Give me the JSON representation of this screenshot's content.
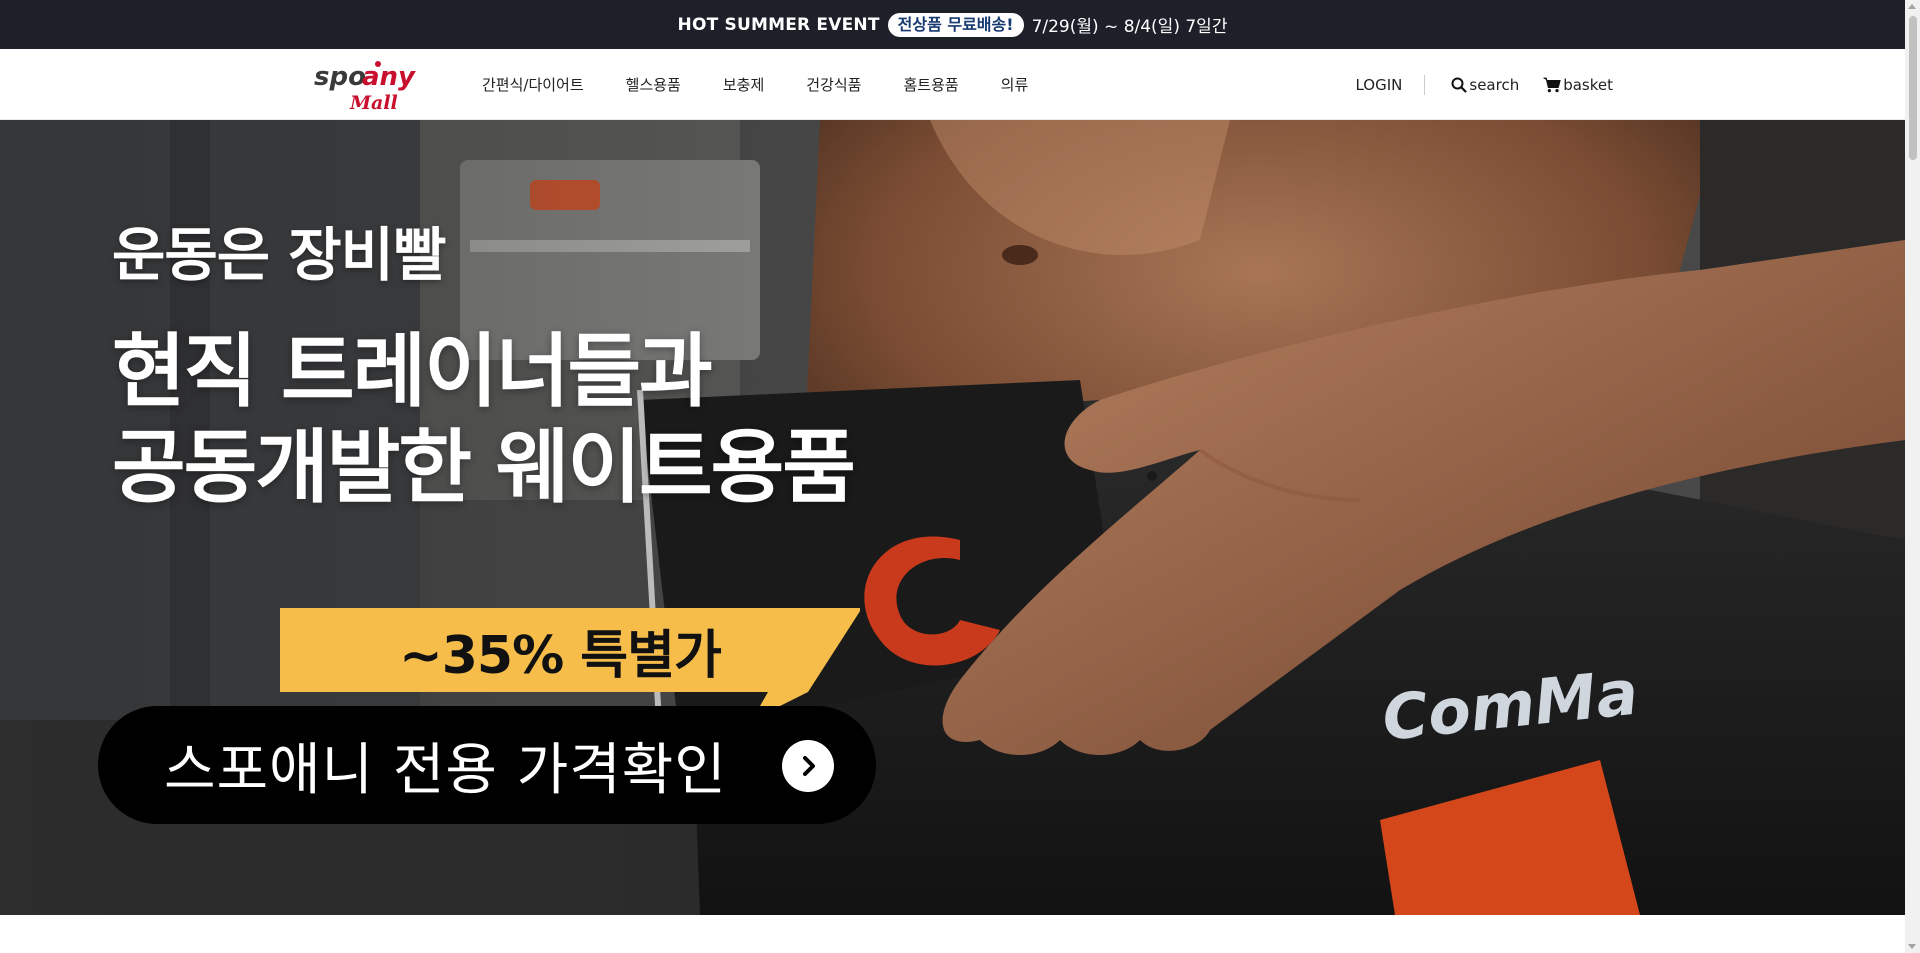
{
  "event_bar": {
    "title": "HOT SUMMER EVENT",
    "badge": "전상품 무료배송!",
    "dates": "7/29(월) ~ 8/4(일) 7일간",
    "background": "#1d1f29",
    "badge_text_color": "#163a70"
  },
  "header": {
    "logo_alt": "spoany mall",
    "logo_word_top": "spo",
    "logo_word_top_suffix": "any",
    "logo_word_bottom": "Mall",
    "nav": [
      {
        "label": "간편식/다이어트"
      },
      {
        "label": "헬스용품"
      },
      {
        "label": "보충제"
      },
      {
        "label": "건강식품"
      },
      {
        "label": "홈트용품"
      },
      {
        "label": "의류"
      }
    ],
    "login": "LOGIN",
    "search": "search",
    "basket": "basket",
    "search_icon": "search-icon",
    "basket_icon": "cart-icon"
  },
  "hero": {
    "subtitle": "운동은 장비빨",
    "title_line1": "현직 트레이너들과",
    "title_line2": "공동개발한 웨이트용품",
    "promo": "~35% 특별가",
    "promo_color": "#f6bd4b",
    "cta": "스포애니 전용 가격확인",
    "cta_icon": "chevron-right-icon",
    "belt_brand": "ComMa",
    "accent_orange": "#d4471b"
  }
}
